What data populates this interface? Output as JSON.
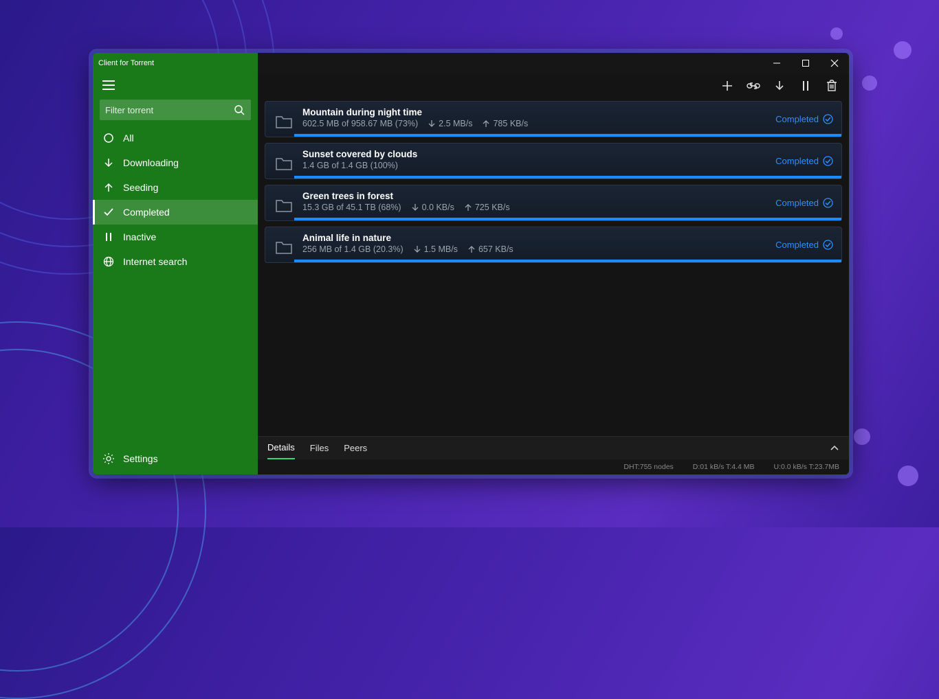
{
  "app_title": "Client for Torrent",
  "filter_placeholder": "Filter torrent",
  "sidebar": {
    "items": [
      {
        "label": "All"
      },
      {
        "label": "Downloading"
      },
      {
        "label": "Seeding"
      },
      {
        "label": "Completed"
      },
      {
        "label": "Inactive"
      },
      {
        "label": "Internet search"
      }
    ],
    "active_index": 3,
    "settings_label": "Settings"
  },
  "torrents": [
    {
      "title": "Mountain during night time",
      "size_line": "602.5 MB of 958.67 MB (73%)",
      "down": "2.5 MB/s",
      "up": "785 KB/s",
      "status": "Completed",
      "progress": 100
    },
    {
      "title": "Sunset covered by clouds",
      "size_line": "1.4 GB of 1.4 GB (100%)",
      "down": "",
      "up": "",
      "status": "Completed",
      "progress": 100
    },
    {
      "title": "Green trees in forest",
      "size_line": "15.3 GB of 45.1 TB (68%)",
      "down": "0.0 KB/s",
      "up": "725 KB/s",
      "status": "Completed",
      "progress": 100
    },
    {
      "title": "Animal life in nature",
      "size_line": "256 MB of 1.4 GB (20.3%)",
      "down": "1.5 MB/s",
      "up": "657 KB/s",
      "status": "Completed",
      "progress": 100
    }
  ],
  "bottom_tabs": [
    "Details",
    "Files",
    "Peers"
  ],
  "bottom_active_index": 0,
  "status_bar": {
    "dht": "DHT:755 nodes",
    "down": "D:01 kB/s T:4.4 MB",
    "up": "U:0.0 kB/s T:23.7MB"
  }
}
